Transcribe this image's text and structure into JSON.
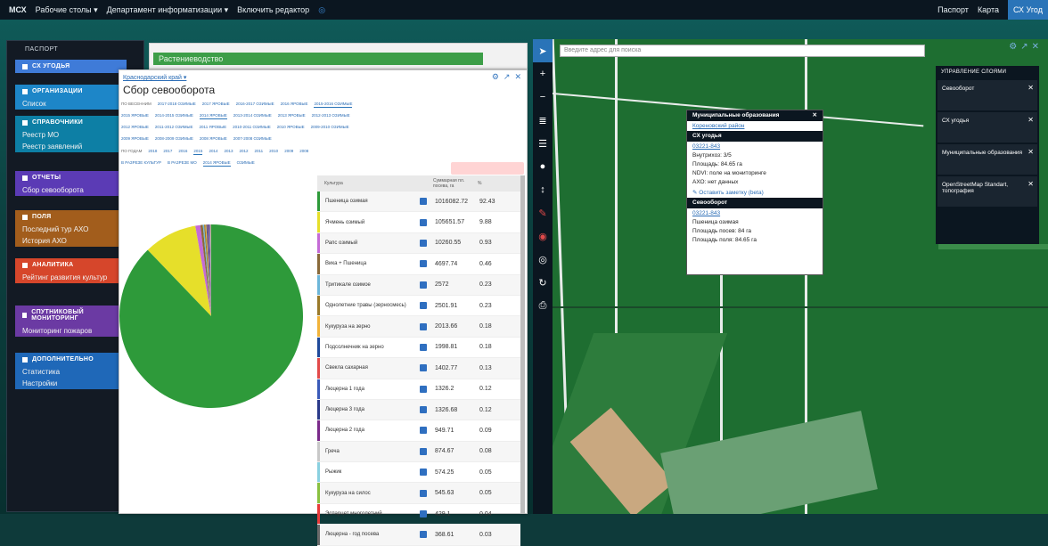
{
  "topbar": {
    "app": "МСХ",
    "menu": [
      "Рабочие столы ▾",
      "Департамент информатизации ▾",
      "Включить редактор"
    ],
    "right": {
      "passport": "Паспорт",
      "map": "Карта",
      "active": "СХ Угод"
    }
  },
  "left_panel": {
    "header": "ПАСПОРТ",
    "groups": [
      {
        "title": "СХ УГОДЬЯ",
        "color": "#3f7bd8",
        "items": []
      },
      {
        "title": "ОРГАНИЗАЦИИ",
        "color": "#1d86c8",
        "items": [
          "Список"
        ]
      },
      {
        "title": "СПРАВОЧНИКИ",
        "color": "#0d7fa5",
        "items": [
          "Реестр МО",
          "Реестр заявлений"
        ]
      },
      {
        "title": "ОТЧЕТЫ",
        "color": "#5b3bb5",
        "items": [
          "Сбор севооборота"
        ]
      },
      {
        "title": "ПОЛЯ",
        "color": "#a25d1c",
        "items": [
          "Последний тур АХО",
          "История АХО"
        ]
      },
      {
        "title": "АНАЛИТИКА",
        "color": "#d6462b",
        "items": [
          "Рейтинг развития культур"
        ]
      },
      {
        "title": "СПУТНИКОВЫЙ МОНИТОРИНГ",
        "color": "#6b3aa3",
        "items": [
          "Мониторинг пожаров"
        ]
      },
      {
        "title": "ДОПОЛНИТЕЛЬНО",
        "color": "#1f68b8",
        "items": [
          "Статистика",
          "Настройки"
        ]
      }
    ]
  },
  "bg_window": {
    "title": "Растениеводство"
  },
  "window": {
    "breadcrumb": "Краснодарский край ▾",
    "title": "Сбор севооборота",
    "tab_rows": [
      [
        "ПО ВЕСЕННИМ",
        "2017-2018 ОЗИМЫЕ",
        "2017 ЯРОВЫЕ",
        "2016-2017 ОЗИМЫЕ",
        "2016 ЯРОВЫЕ",
        "2015-2016 ОЗИМЫЕ"
      ],
      [
        "2015 ЯРОВЫЕ",
        "2014-2015 ОЗИМЫЕ",
        "2014 ЯРОВЫЕ",
        "2013-2014 ОЗИМЫЕ",
        "2013 ЯРОВЫЕ",
        "2012-2013 ОЗИМЫЕ"
      ],
      [
        "2012 ЯРОВЫЕ",
        "2011-2012 ОЗИМЫЕ",
        "2011 ЯРОВЫЕ",
        "2010-2011 ОЗИМЫЕ",
        "2010 ЯРОВЫЕ",
        "2009-2010 ОЗИМЫЕ"
      ],
      [
        "2009 ЯРОВЫЕ",
        "2008-2009 ОЗИМЫЕ",
        "2008 ЯРОВЫЕ",
        "2007-2008 ОЗИМЫЕ"
      ],
      [
        "ПО ГОДАМ",
        "2018",
        "2017",
        "2016",
        "2015",
        "2014",
        "2013",
        "2012",
        "2011",
        "2010",
        "2009",
        "2008"
      ],
      [
        "В РАЗРЕЗЕ КУЛЬТУР",
        "В РАЗРЕЗЕ МО",
        "2014 ЯРОВЫЕ",
        "ОЗИМЫЕ"
      ]
    ],
    "selected_tabs": [
      "2015-2016 ОЗИМЫЕ",
      "2015",
      "2014 ЯРОВЫЕ"
    ],
    "table": {
      "headers": [
        "Культура",
        "",
        "Суммарная пл. посева, га",
        "%"
      ],
      "rows": [
        {
          "name": "Пшеница озимая",
          "value": "1016082.72",
          "pct": "92.43",
          "color": "#2e9a3a"
        },
        {
          "name": "Ячмень озимый",
          "value": "105651.57",
          "pct": "9.88",
          "color": "#e6df2a"
        },
        {
          "name": "Рапс озимый",
          "value": "10260.55",
          "pct": "0.93",
          "color": "#c46bd6"
        },
        {
          "name": "Вика + Пшеница",
          "value": "4697.74",
          "pct": "0.46",
          "color": "#8a6a3a"
        },
        {
          "name": "Тритикале озимое",
          "value": "2572",
          "pct": "0.23",
          "color": "#6db6d9"
        },
        {
          "name": "Однолетние травы (зерносмесь)",
          "value": "2501.91",
          "pct": "0.23",
          "color": "#9a7a2a"
        },
        {
          "name": "Кукуруза на зерно",
          "value": "2013.66",
          "pct": "0.18",
          "color": "#f2b33a"
        },
        {
          "name": "Подсолнечник на зерно",
          "value": "1998.81",
          "pct": "0.18",
          "color": "#1f4a9a"
        },
        {
          "name": "Свекла сахарная",
          "value": "1402.77",
          "pct": "0.13",
          "color": "#e24a4a"
        },
        {
          "name": "Люцерна 1 года",
          "value": "1326.2",
          "pct": "0.12",
          "color": "#3a5ab8"
        },
        {
          "name": "Люцерна 3 года",
          "value": "1326.68",
          "pct": "0.12",
          "color": "#2a3a8a"
        },
        {
          "name": "Люцерна 2 года",
          "value": "949.71",
          "pct": "0.09",
          "color": "#7a2a8a"
        },
        {
          "name": "Греча",
          "value": "874.67",
          "pct": "0.08",
          "color": "#c8c8c8"
        },
        {
          "name": "Рыжик",
          "value": "574.25",
          "pct": "0.05",
          "color": "#8ad0e0"
        },
        {
          "name": "Кукуруза на силос",
          "value": "545.63",
          "pct": "0.05",
          "color": "#8ac040"
        },
        {
          "name": "Эспарцет многолетний",
          "value": "429.1",
          "pct": "0.04",
          "color": "#e83a3a"
        },
        {
          "name": "Люцерна - год посева",
          "value": "368.61",
          "pct": "0.03",
          "color": "#6a6a6a"
        }
      ]
    }
  },
  "chart_data": {
    "type": "pie",
    "slices": [
      {
        "label": "Пшеница озимая",
        "value": 92.43,
        "color": "#2e9a3a"
      },
      {
        "label": "Ячмень озимый",
        "value": 9.88,
        "color": "#e6df2a"
      },
      {
        "label": "Рапс озимый",
        "value": 0.93,
        "color": "#c46bd6"
      },
      {
        "label": "Вика + Пшеница",
        "value": 0.46,
        "color": "#8a6a3a"
      },
      {
        "label": "Тритикале озимое",
        "value": 0.23,
        "color": "#6db6d9"
      },
      {
        "label": "Однолетние травы (зерносмесь)",
        "value": 0.23,
        "color": "#9a7a2a"
      },
      {
        "label": "Кукуруза на зерно",
        "value": 0.18,
        "color": "#f2b33a"
      },
      {
        "label": "Подсолнечник на зерно",
        "value": 0.18,
        "color": "#1f4a9a"
      },
      {
        "label": "Свекла сахарная",
        "value": 0.13,
        "color": "#e24a4a"
      },
      {
        "label": "Люцерна 1 года",
        "value": 0.12,
        "color": "#3a5ab8"
      },
      {
        "label": "Люцерна 3 года",
        "value": 0.12,
        "color": "#2a3a8a"
      },
      {
        "label": "Люцерна 2 года",
        "value": 0.09,
        "color": "#7a2a8a"
      },
      {
        "label": "Греча",
        "value": 0.08,
        "color": "#c8c8c8"
      },
      {
        "label": "Рыжик",
        "value": 0.05,
        "color": "#8ad0e0"
      },
      {
        "label": "Кукуруза на силос",
        "value": 0.05,
        "color": "#8ac040"
      },
      {
        "label": "Эспарцет многолетний",
        "value": 0.04,
        "color": "#e83a3a"
      },
      {
        "label": "Люцерна - год посева",
        "value": 0.03,
        "color": "#6a6a6a"
      }
    ]
  },
  "map": {
    "address_placeholder": "Введите адрес для поиска",
    "layers_title": "УПРАВЛЕНИЕ СЛОЯМИ",
    "layers": [
      "Севооборот",
      "СХ угодья",
      "Муниципальные образования",
      "OpenStreetMap Standart, топография"
    ],
    "popup": {
      "mo_title": "Муниципальные образования",
      "mo_link": "Кореновский район",
      "cx_title": "СХ угодья",
      "cx_link": "03221-843",
      "cx_lines": [
        "Внутрихоз: 3/5",
        "Площадь: 84.65 га",
        "NDVI: поле на мониторинге",
        "АХО: нет данных"
      ],
      "edit": "Оставить заметку (beta)",
      "sev_title": "Севооборот",
      "sev_link": "03221-843",
      "sev_lines": [
        "Пшеница озимая",
        "Площадь посев: 84 га",
        "Площадь поля: 84.65 га"
      ]
    }
  }
}
